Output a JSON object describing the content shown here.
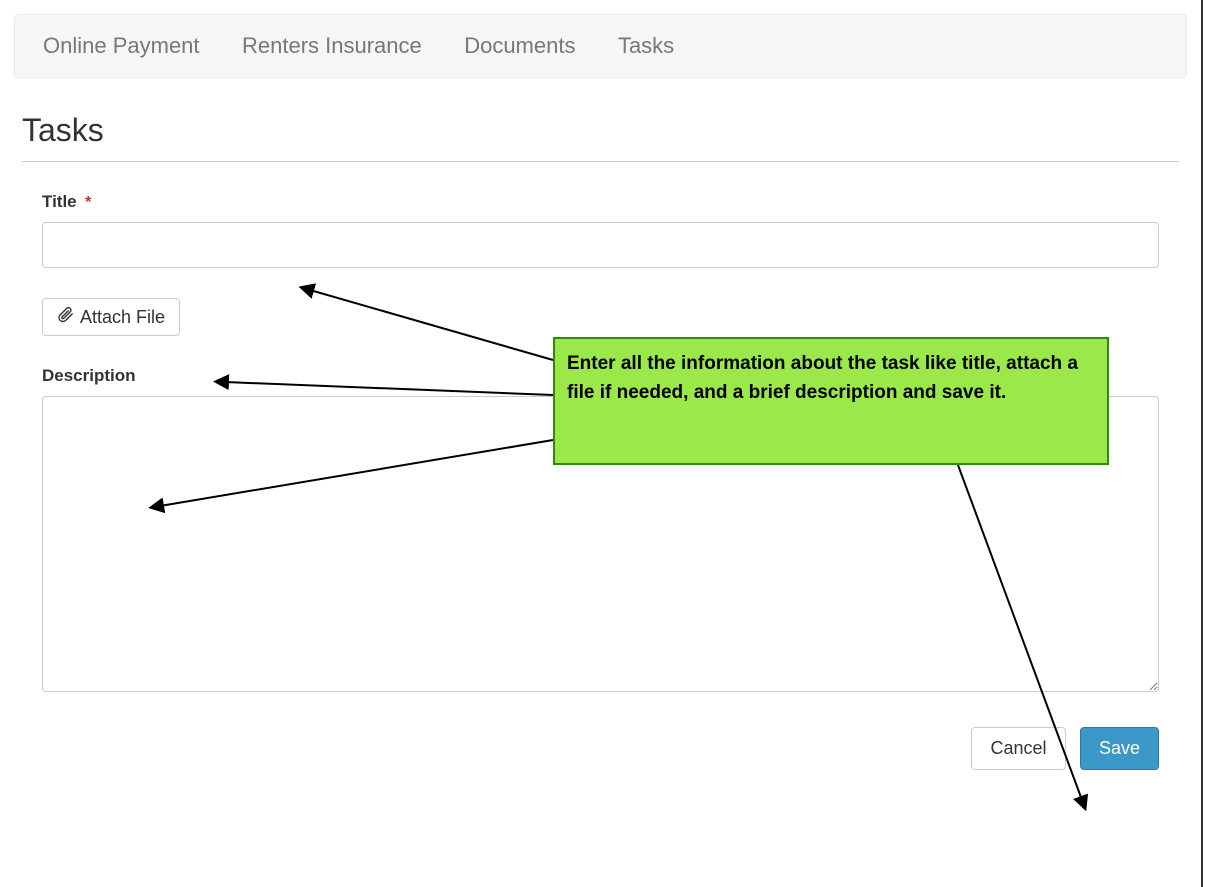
{
  "nav": {
    "items": [
      {
        "label": "Online Payment"
      },
      {
        "label": "Renters Insurance"
      },
      {
        "label": "Documents"
      },
      {
        "label": "Tasks"
      }
    ]
  },
  "page": {
    "title": "Tasks"
  },
  "form": {
    "title_label": "Title",
    "required_mark": "*",
    "title_value": "",
    "attach_label": "Attach File",
    "description_label": "Description",
    "description_value": ""
  },
  "buttons": {
    "cancel": "Cancel",
    "save": "Save"
  },
  "annotation": {
    "text": "Enter all the information about the task like title, attach a file if needed, and a brief description and save it."
  }
}
